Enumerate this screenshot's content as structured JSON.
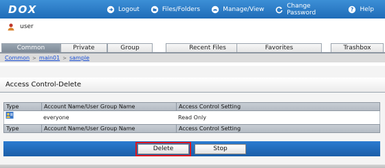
{
  "app": {
    "logo_text": "DOX"
  },
  "nav": {
    "items": [
      {
        "label": "Logout",
        "icon": "logout-icon"
      },
      {
        "label": "Files/Folders",
        "icon": "files-folders-icon"
      },
      {
        "label": "Manage/View",
        "icon": "manage-view-icon"
      },
      {
        "label": "Change Password",
        "icon": "change-password-icon"
      },
      {
        "label": "Help",
        "icon": "help-icon"
      }
    ]
  },
  "user": {
    "name": "user",
    "icon": "user-avatar-icon"
  },
  "tabs": [
    {
      "label": "Common",
      "active": true
    },
    {
      "label": "Private",
      "active": false
    },
    {
      "label": "Group",
      "active": false
    },
    {
      "label": "Recent Files",
      "active": false
    },
    {
      "label": "Favorites",
      "active": false
    },
    {
      "label": "Trashbox",
      "active": false
    }
  ],
  "breadcrumb": [
    "Common",
    "main01",
    "sample"
  ],
  "section": {
    "title": "Access Control-Delete"
  },
  "table": {
    "headers": [
      "Type",
      "Account Name/User Group Name",
      "Access Control Setting"
    ],
    "rows": [
      {
        "type_icon": "user-group-icon",
        "name": "everyone",
        "setting": "Read Only"
      }
    ]
  },
  "buttons": {
    "delete": "Delete",
    "stop": "Stop"
  },
  "colors": {
    "nav_blue": "#2b7bd0",
    "highlight": "#e0141b",
    "link": "#1a4fd6"
  }
}
